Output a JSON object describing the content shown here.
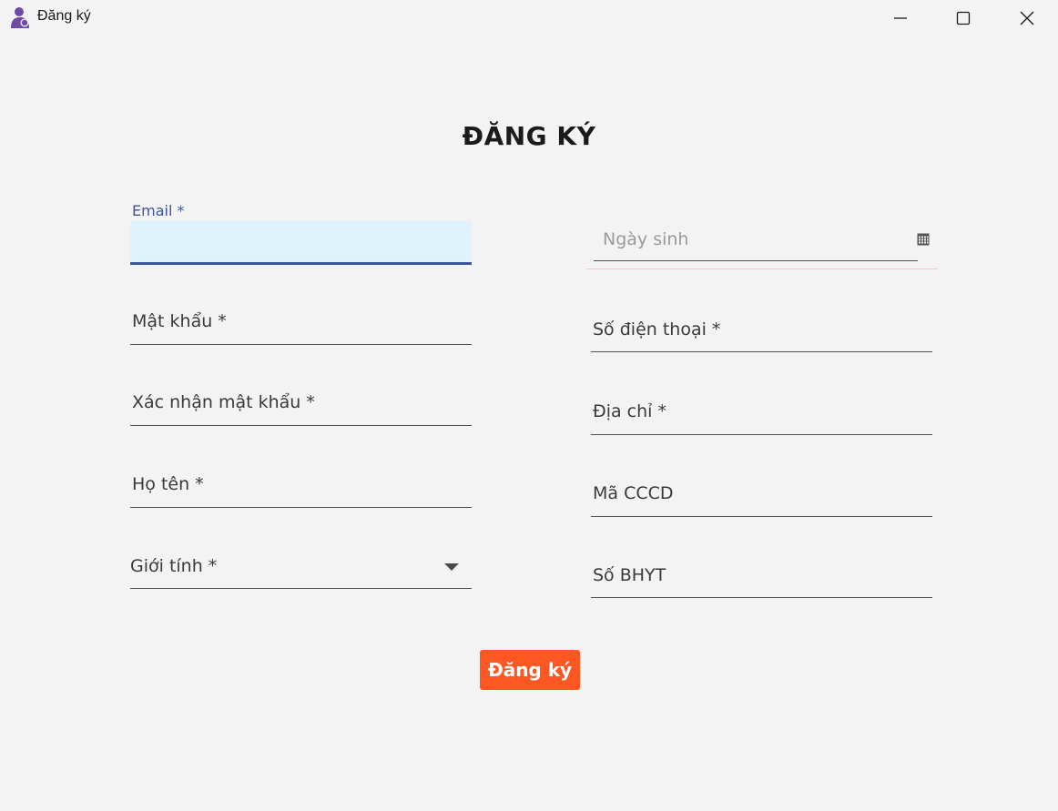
{
  "window": {
    "title": "Đăng ký",
    "app_icon": "mother-child-icon",
    "controls": [
      "minimize-icon",
      "maximize-icon",
      "close-icon"
    ]
  },
  "form": {
    "heading": "ĐĂNG KÝ",
    "left_fields": {
      "email": {
        "label": "Email *",
        "value": ""
      },
      "password": {
        "label": "Mật khẩu *"
      },
      "confirm_password": {
        "label": "Xác nhận mật khẩu *"
      },
      "full_name": {
        "label": "Họ tên *"
      },
      "gender": {
        "label": "Giới tính *",
        "icon": "dropdown-arrow-icon"
      }
    },
    "right_fields": {
      "birth_date": {
        "placeholder": "Ngày sinh",
        "icon": "calendar-icon"
      },
      "phone": {
        "label": "Số điện thoại *"
      },
      "address": {
        "label": "Địa chỉ *"
      },
      "citizen_id": {
        "label": "Mã CCCD"
      },
      "insurance": {
        "label": "Số BHYT"
      }
    },
    "submit_label": "Đăng ký"
  },
  "colors": {
    "background": "#f3f3f3",
    "accent_focus": "#3b5699",
    "focus_fill": "#dff3fd",
    "submit_button": "#ff5722",
    "error_line": "#f6c6d0"
  }
}
